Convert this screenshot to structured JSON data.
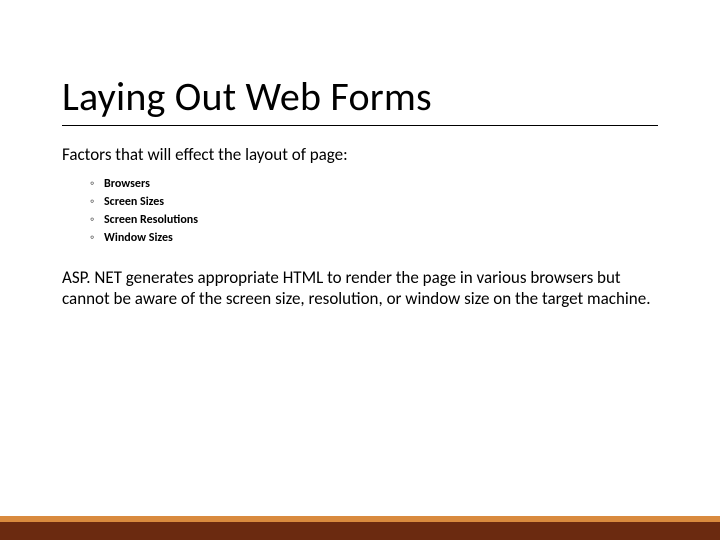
{
  "slide": {
    "title": "Laying Out Web Forms",
    "subtitle": "Factors that will effect the layout of page:",
    "bullets": [
      "Browsers",
      "Screen Sizes",
      "Screen Resolutions",
      "Window Sizes"
    ],
    "body": "ASP. NET generates appropriate HTML to render the page in various browsers but cannot be aware of the screen size, resolution, or window size on the target machine."
  }
}
